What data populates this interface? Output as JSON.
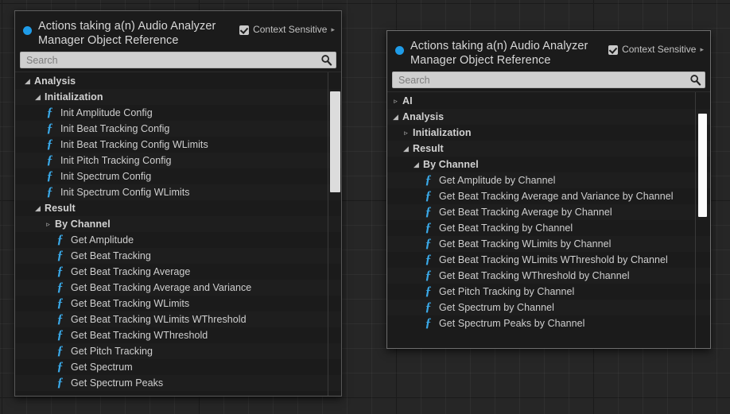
{
  "canvas": {
    "background_color": "#262626",
    "grid_color": "#2f2f2f"
  },
  "accent": {
    "dot_color": "#1f9ce8",
    "function_icon_color": "#3aa9e8"
  },
  "icons": {
    "search": "search-icon",
    "checkmark": "check-icon",
    "expander_open": "triangle-down-icon",
    "expander_closed": "triangle-right-icon",
    "context_arrow": "chevron-right-icon",
    "function": "function-f-icon"
  },
  "left_panel": {
    "title": "Actions taking a(n) Audio Analyzer\nManager Object Reference",
    "context_sensitive": {
      "label": "Context Sensitive",
      "checked": true,
      "arrow": "▸"
    },
    "search": {
      "value": "",
      "placeholder": "Search"
    },
    "tree": [
      {
        "depth": 0,
        "type": "category",
        "state": "expanded",
        "twisty": "◢",
        "label": "Analysis"
      },
      {
        "depth": 1,
        "type": "category",
        "state": "expanded",
        "twisty": "◢",
        "label": "Initialization"
      },
      {
        "depth": 2,
        "type": "function",
        "icon": "ƒ",
        "label": "Init Amplitude Config"
      },
      {
        "depth": 2,
        "type": "function",
        "icon": "ƒ",
        "label": "Init Beat Tracking Config"
      },
      {
        "depth": 2,
        "type": "function",
        "icon": "ƒ",
        "label": "Init Beat Tracking Config WLimits"
      },
      {
        "depth": 2,
        "type": "function",
        "icon": "ƒ",
        "label": "Init Pitch Tracking Config"
      },
      {
        "depth": 2,
        "type": "function",
        "icon": "ƒ",
        "label": "Init Spectrum Config"
      },
      {
        "depth": 2,
        "type": "function",
        "icon": "ƒ",
        "label": "Init Spectrum Config WLimits"
      },
      {
        "depth": 1,
        "type": "category",
        "state": "expanded",
        "twisty": "◢",
        "label": "Result"
      },
      {
        "depth": 2,
        "type": "category",
        "state": "collapsed",
        "twisty": "▹",
        "label": "By Channel"
      },
      {
        "depth": 3,
        "type": "function",
        "icon": "ƒ",
        "label": "Get Amplitude"
      },
      {
        "depth": 3,
        "type": "function",
        "icon": "ƒ",
        "label": "Get Beat Tracking"
      },
      {
        "depth": 3,
        "type": "function",
        "icon": "ƒ",
        "label": "Get Beat Tracking Average"
      },
      {
        "depth": 3,
        "type": "function",
        "icon": "ƒ",
        "label": "Get Beat Tracking Average and Variance"
      },
      {
        "depth": 3,
        "type": "function",
        "icon": "ƒ",
        "label": "Get Beat Tracking WLimits"
      },
      {
        "depth": 3,
        "type": "function",
        "icon": "ƒ",
        "label": "Get Beat Tracking WLimits WThreshold"
      },
      {
        "depth": 3,
        "type": "function",
        "icon": "ƒ",
        "label": "Get Beat Tracking WThreshold"
      },
      {
        "depth": 3,
        "type": "function",
        "icon": "ƒ",
        "label": "Get Pitch Tracking"
      },
      {
        "depth": 3,
        "type": "function",
        "icon": "ƒ",
        "label": "Get Spectrum"
      },
      {
        "depth": 3,
        "type": "function",
        "icon": "ƒ",
        "label": "Get Spectrum Peaks"
      }
    ]
  },
  "right_panel": {
    "title": "Actions taking a(n) Audio Analyzer\nManager Object Reference",
    "context_sensitive": {
      "label": "Context Sensitive",
      "checked": true,
      "arrow": "▸"
    },
    "search": {
      "value": "",
      "placeholder": "Search"
    },
    "tree": [
      {
        "depth": 0,
        "type": "category",
        "state": "collapsed",
        "twisty": "▹",
        "label": "AI"
      },
      {
        "depth": 0,
        "type": "category",
        "state": "expanded",
        "twisty": "◢",
        "label": "Analysis"
      },
      {
        "depth": 1,
        "type": "category",
        "state": "collapsed",
        "twisty": "▹",
        "label": "Initialization"
      },
      {
        "depth": 1,
        "type": "category",
        "state": "expanded",
        "twisty": "◢",
        "label": "Result"
      },
      {
        "depth": 2,
        "type": "category",
        "state": "expanded",
        "twisty": "◢",
        "label": "By Channel"
      },
      {
        "depth": 3,
        "type": "function",
        "icon": "ƒ",
        "label": "Get Amplitude by Channel"
      },
      {
        "depth": 3,
        "type": "function",
        "icon": "ƒ",
        "label": "Get Beat Tracking Average and Variance by Channel"
      },
      {
        "depth": 3,
        "type": "function",
        "icon": "ƒ",
        "label": "Get Beat Tracking Average by Channel"
      },
      {
        "depth": 3,
        "type": "function",
        "icon": "ƒ",
        "label": "Get Beat Tracking by Channel"
      },
      {
        "depth": 3,
        "type": "function",
        "icon": "ƒ",
        "label": "Get Beat Tracking WLimits by Channel"
      },
      {
        "depth": 3,
        "type": "function",
        "icon": "ƒ",
        "label": "Get Beat Tracking WLimits WThreshold by Channel"
      },
      {
        "depth": 3,
        "type": "function",
        "icon": "ƒ",
        "label": "Get Beat Tracking WThreshold by Channel"
      },
      {
        "depth": 3,
        "type": "function",
        "icon": "ƒ",
        "label": "Get Pitch Tracking by Channel"
      },
      {
        "depth": 3,
        "type": "function",
        "icon": "ƒ",
        "label": "Get Spectrum by Channel"
      },
      {
        "depth": 3,
        "type": "function",
        "icon": "ƒ",
        "label": "Get Spectrum Peaks by Channel"
      }
    ]
  }
}
